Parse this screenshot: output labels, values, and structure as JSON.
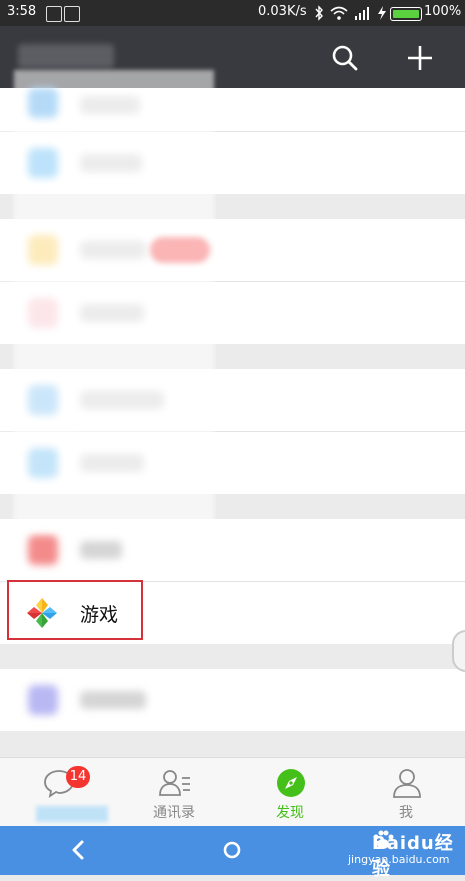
{
  "status": {
    "time": "3:58",
    "speed": "0.03K/s",
    "battery": "100%"
  },
  "list": {
    "games_label": "游戏"
  },
  "tabbar": {
    "chats_badge": "14",
    "contacts_label": "通讯录",
    "discover_label": "发现",
    "me_label": "我"
  },
  "colors": {
    "appbar": "#393a3f",
    "accent_green": "#45c01a",
    "badge_red": "#f43530",
    "nav_blue": "#4a90e2",
    "highlight_red": "#d4313a"
  },
  "watermark": {
    "brand": "Baidu经验",
    "url": "jingyan.baidu.com"
  }
}
